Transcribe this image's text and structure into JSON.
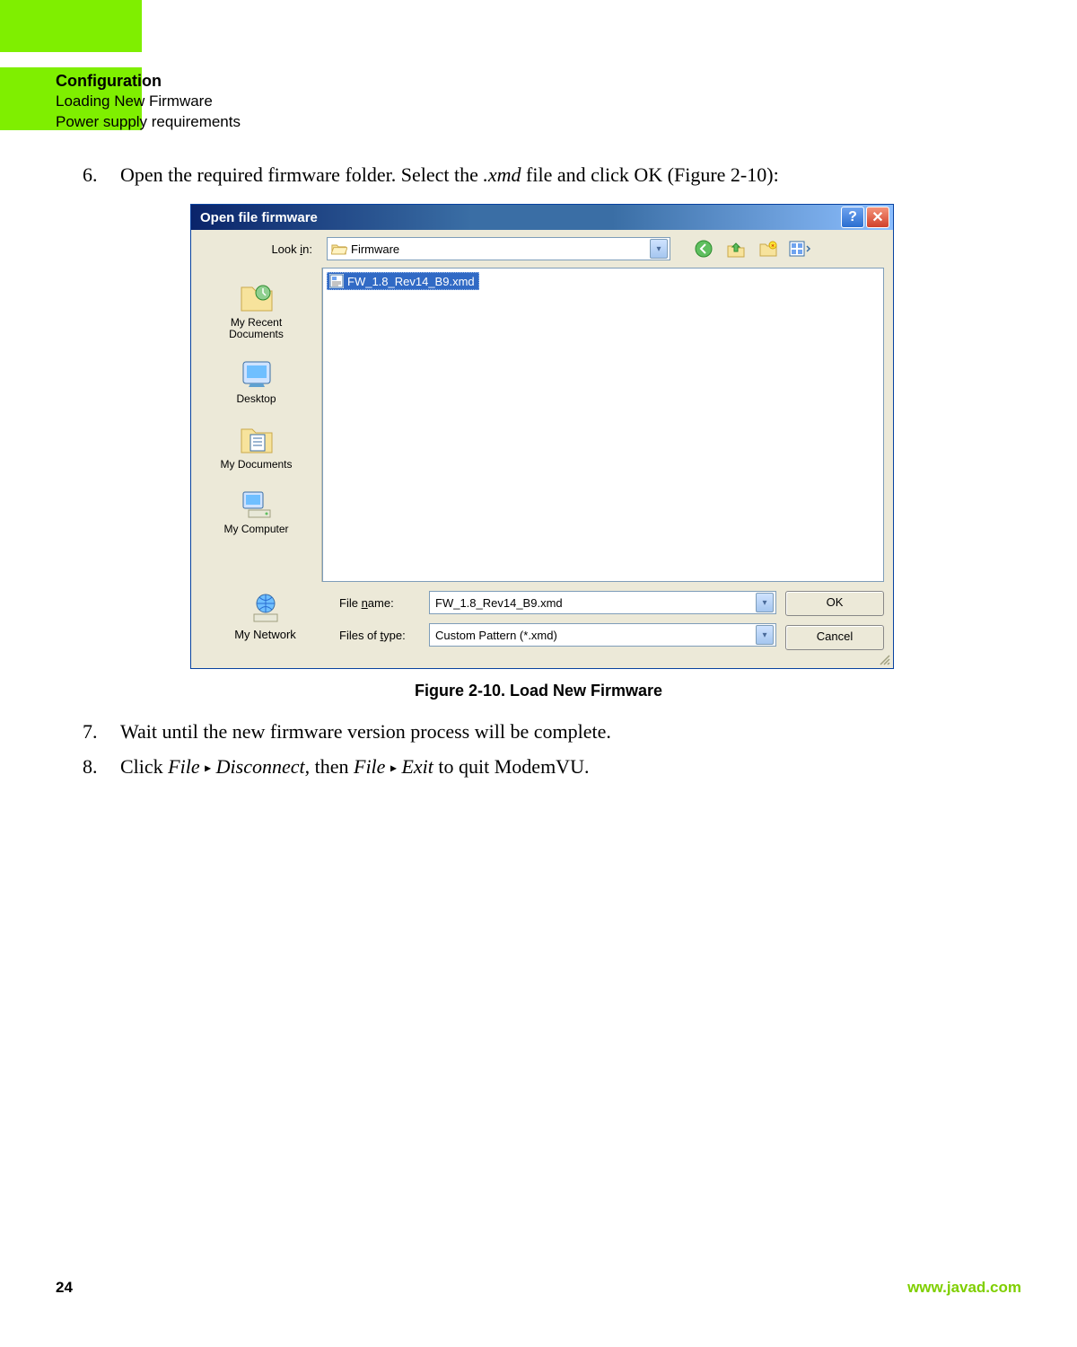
{
  "header": {
    "title": "Configuration",
    "sub1": "Loading New Firmware",
    "sub2": "Power supply requirements"
  },
  "steps": {
    "s6_num": "6.",
    "s6_a": "Open the required firmware folder. Select the ",
    "s6_b": ".xmd",
    "s6_c": " file and click OK (Figure 2-10):",
    "s7_num": "7.",
    "s7": "Wait until the new firmware version process will be complete.",
    "s8_num": "8.",
    "s8_a": "Click ",
    "s8_b": "File",
    "s8_c": "Disconnect",
    "s8_d": ", then ",
    "s8_e": "File",
    "s8_f": "Exit",
    "s8_g": " to quit ModemVU."
  },
  "triangle": "▸",
  "figure_caption": "Figure 2-10. Load New Firmware",
  "dialog": {
    "title": "Open file firmware",
    "help": "?",
    "close": "✕",
    "lookin_label_pre": "Look ",
    "lookin_label_u": "i",
    "lookin_label_post": "n:",
    "lookin_value": "Firmware",
    "places": {
      "recent": "My Recent\nDocuments",
      "desktop": "Desktop",
      "mydocs": "My Documents",
      "mycomp": "My Computer",
      "mynet": "My Network"
    },
    "file_item": "FW_1.8_Rev14_B9.xmd",
    "filename_label_pre": "File ",
    "filename_label_u": "n",
    "filename_label_post": "ame:",
    "filename_value": "FW_1.8_Rev14_B9.xmd",
    "filetype_label_pre": "Files of ",
    "filetype_label_u": "t",
    "filetype_label_post": "ype:",
    "filetype_value": "Custom Pattern (*.xmd)",
    "ok": "OK",
    "cancel": "Cancel"
  },
  "footer": {
    "page": "24",
    "url": "www.javad.com"
  }
}
